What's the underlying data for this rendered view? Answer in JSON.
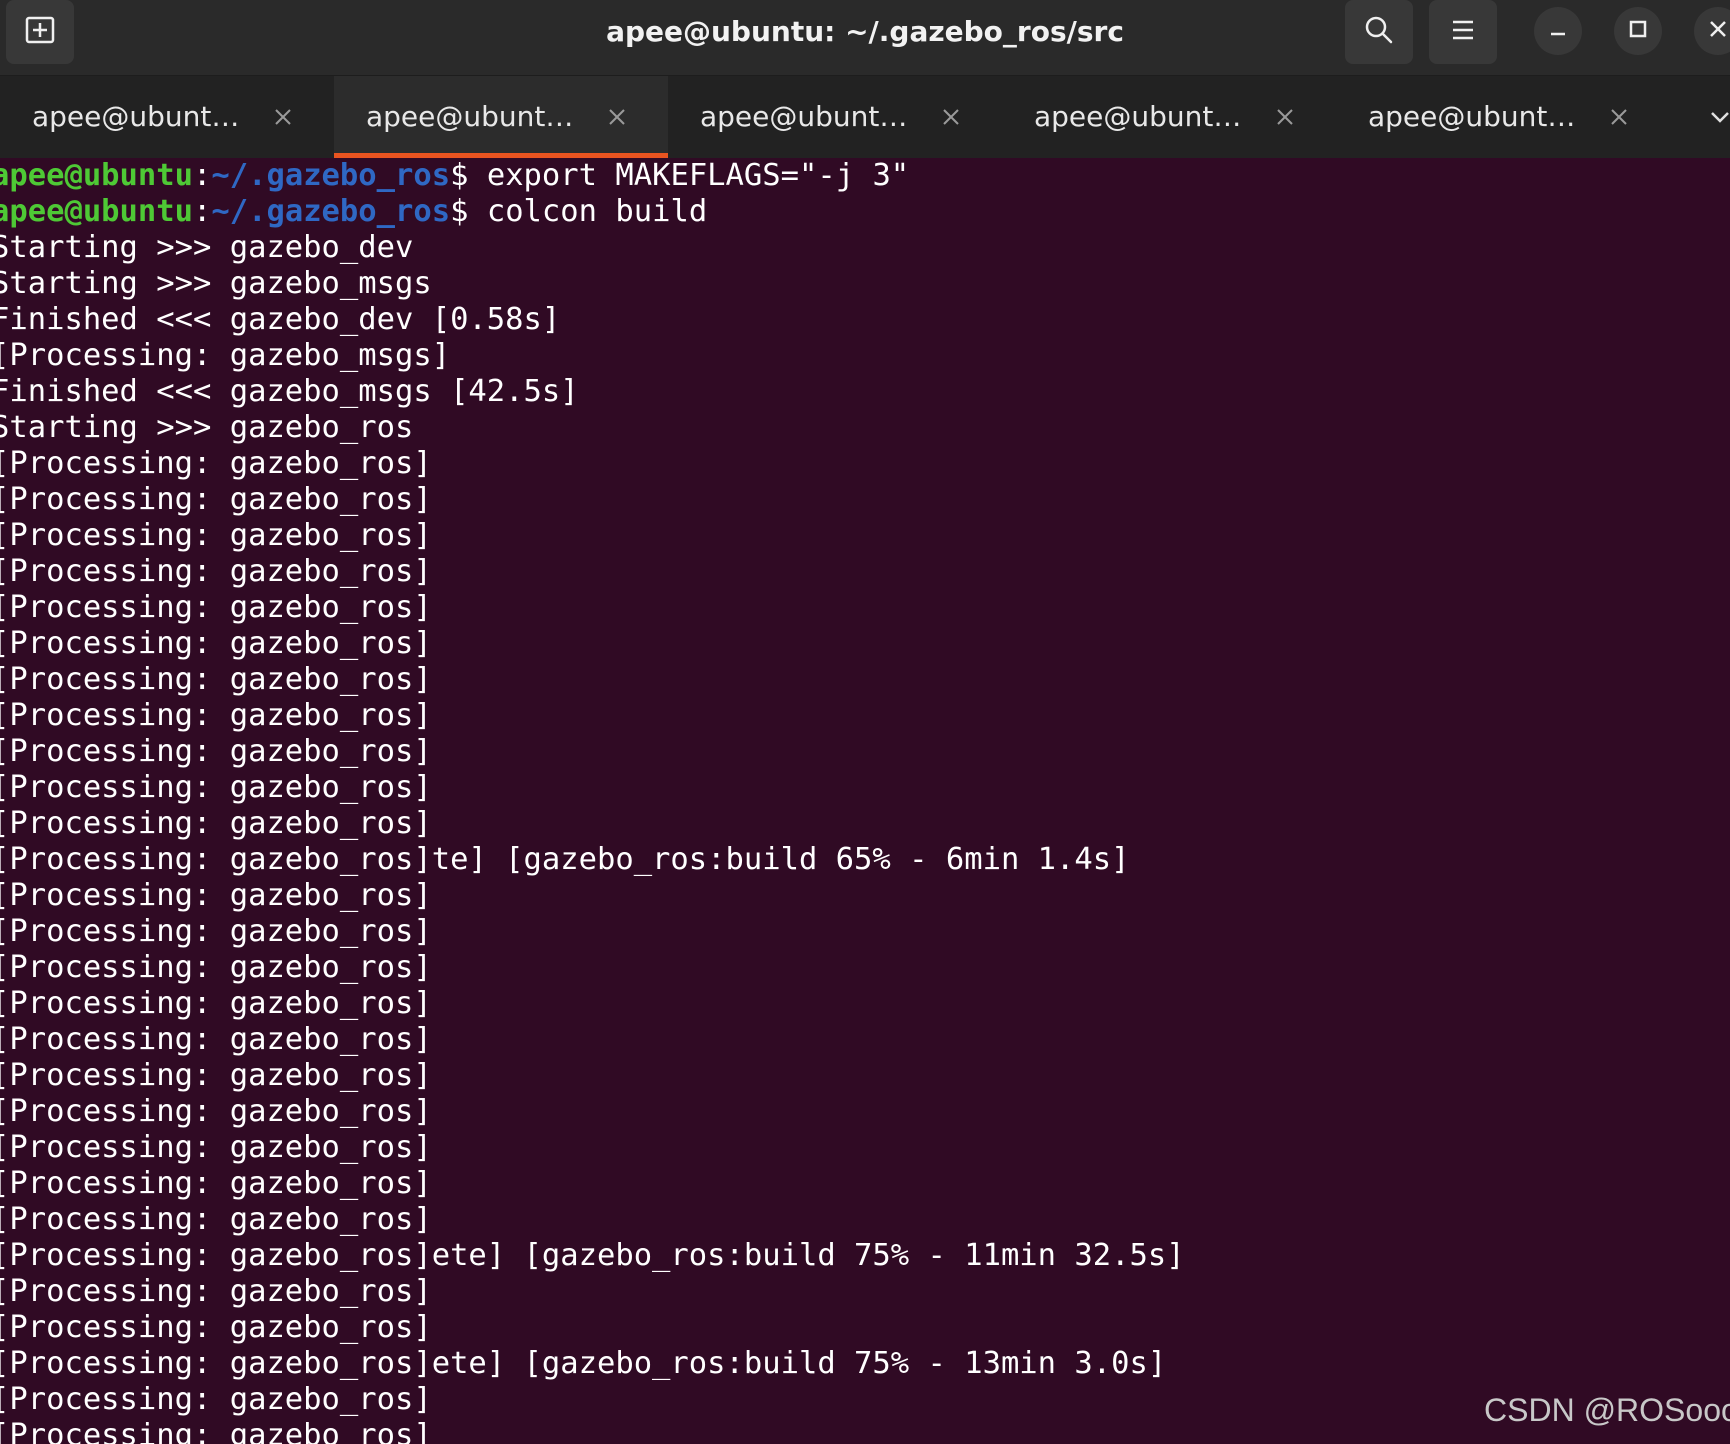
{
  "window": {
    "title": "apee@ubuntu: ~/.gazebo_ros/src"
  },
  "icons": {
    "new_tab": "new-tab-icon",
    "search": "search-icon",
    "menu": "hamburger-menu-icon",
    "minimize": "minimize-icon",
    "maximize": "maximize-icon",
    "close": "close-icon",
    "tab_close": "close-icon",
    "tab_overflow": "chevron-down-icon"
  },
  "colors": {
    "terminal_bg": "#300a24",
    "tab_accent": "#e95420",
    "prompt_user": "#4ec935",
    "prompt_path": "#2f68c4"
  },
  "tabs": [
    {
      "label": "apee@ubunt…",
      "close": "×"
    },
    {
      "label": "apee@ubunt…",
      "close": "×"
    },
    {
      "label": "apee@ubunt…",
      "close": "×"
    },
    {
      "label": "apee@ubunt…",
      "close": "×"
    },
    {
      "label": "apee@ubunt…",
      "close": "×"
    }
  ],
  "active_tab_index": 1,
  "prompt": {
    "user": "apee@ubuntu",
    "colon": ":",
    "path": "~/.gazebo_ros",
    "symbol": "$"
  },
  "terminal": {
    "commands": [
      " export MAKEFLAGS=\"-j 3\"",
      " colcon build"
    ],
    "output": [
      "Starting >>> gazebo_dev",
      "Starting >>> gazebo_msgs",
      "Finished <<< gazebo_dev [0.58s]",
      "[Processing: gazebo_msgs]",
      "Finished <<< gazebo_msgs [42.5s]",
      "Starting >>> gazebo_ros",
      "[Processing: gazebo_ros]",
      "[Processing: gazebo_ros]",
      "[Processing: gazebo_ros]",
      "[Processing: gazebo_ros]",
      "[Processing: gazebo_ros]",
      "[Processing: gazebo_ros]",
      "[Processing: gazebo_ros]",
      "[Processing: gazebo_ros]",
      "[Processing: gazebo_ros]",
      "[Processing: gazebo_ros]",
      "[Processing: gazebo_ros]",
      "[Processing: gazebo_ros]te] [gazebo_ros:build 65% - 6min 1.4s]",
      "[Processing: gazebo_ros]",
      "[Processing: gazebo_ros]",
      "[Processing: gazebo_ros]",
      "[Processing: gazebo_ros]",
      "[Processing: gazebo_ros]",
      "[Processing: gazebo_ros]",
      "[Processing: gazebo_ros]",
      "[Processing: gazebo_ros]",
      "[Processing: gazebo_ros]",
      "[Processing: gazebo_ros]",
      "[Processing: gazebo_ros]ete] [gazebo_ros:build 75% - 11min 32.5s]",
      "[Processing: gazebo_ros]",
      "[Processing: gazebo_ros]",
      "[Processing: gazebo_ros]ete] [gazebo_ros:build 75% - 13min 3.0s]",
      "[Processing: gazebo_ros]",
      "[Processing: gazebo_ros]"
    ]
  },
  "watermark": "CSDN @ROSooo"
}
